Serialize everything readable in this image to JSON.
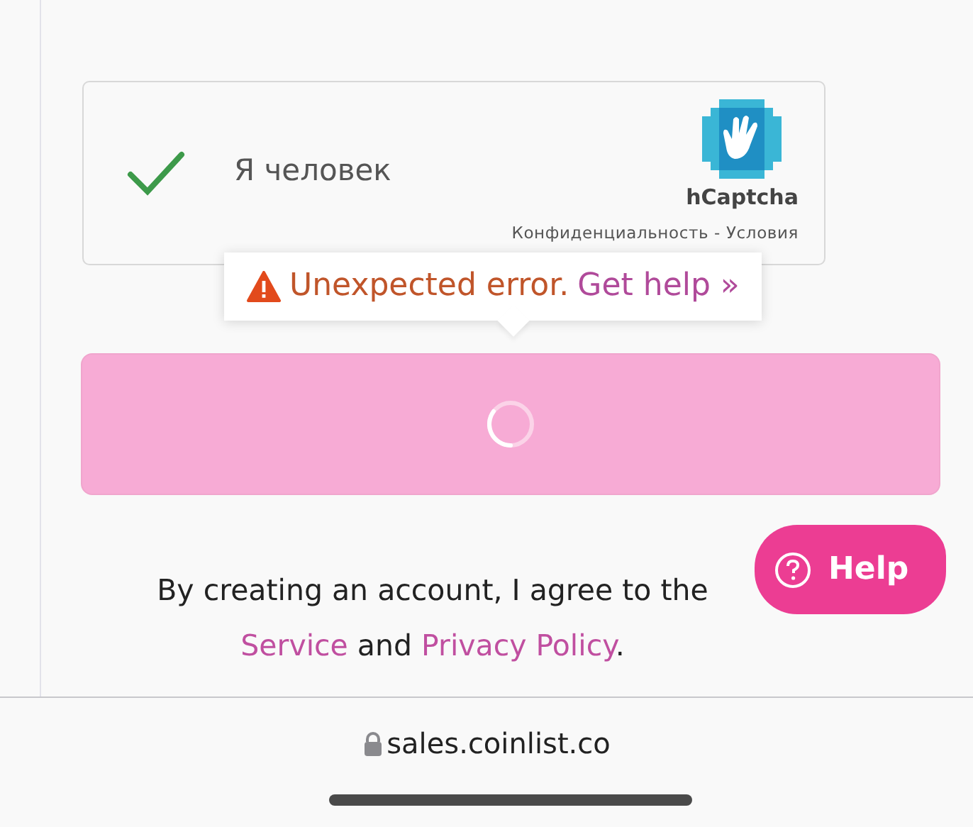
{
  "captcha": {
    "checked": true,
    "label": "Я человек",
    "brand": "hCaptcha",
    "privacy_link": "Конфиденциальность",
    "separator": "-",
    "terms_link": "Условия"
  },
  "error_tooltip": {
    "message": "Unexpected error.",
    "link": "Get help »"
  },
  "submit_button": {
    "loading": true
  },
  "agreement": [
    {
      "kind": "text",
      "text": "By creating an account, I agree to the"
    },
    {
      "kind": "link",
      "text": "Service"
    },
    {
      "kind": "text",
      "text": " and "
    },
    {
      "kind": "link",
      "text": "Privacy Policy"
    },
    {
      "kind": "text",
      "text": "."
    }
  ],
  "help_button": {
    "label": "Help"
  },
  "address_bar": {
    "url": "sales.coinlist.co",
    "secure": true
  }
}
